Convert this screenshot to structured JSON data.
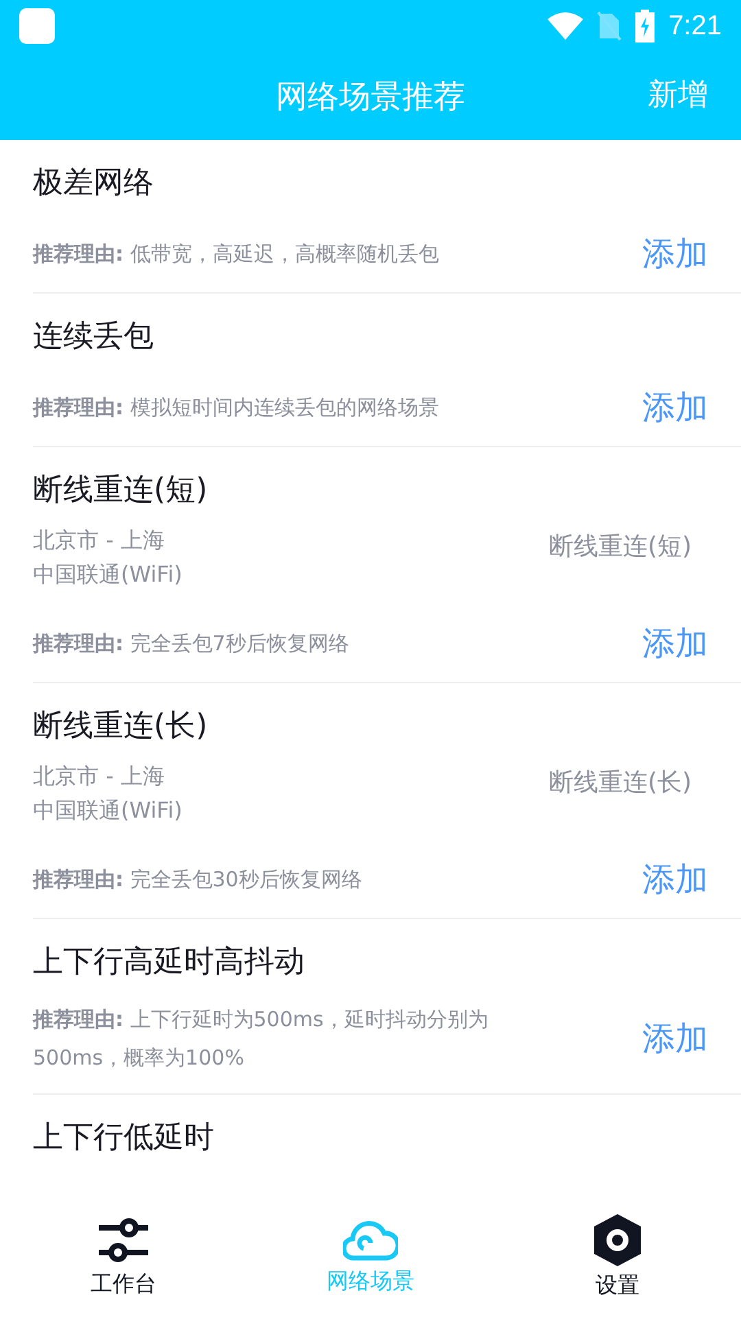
{
  "status_bar": {
    "time": "7:21"
  },
  "app_bar": {
    "title": "网络场景推荐",
    "action": "新增"
  },
  "scenarios": [
    {
      "kind": "simple",
      "title": "极差网络",
      "reason": "**推荐理由:** 低带宽，高延迟，高概率随机丢包",
      "add": "添加"
    },
    {
      "kind": "simple",
      "title": "连续丢包",
      "reason": "**推荐理由:** 模拟短时间内连续丢包的网络场景",
      "add": "添加"
    },
    {
      "kind": "route",
      "title": "断线重连(短)",
      "route": "北京市 - 上海",
      "carrier": "中国联通(WiFi)",
      "tag": "断线重连(短)",
      "reason": "**推荐理由:** 完全丢包7秒后恢复网络",
      "add": "添加"
    },
    {
      "kind": "route",
      "title": "断线重连(长)",
      "route": "北京市 - 上海",
      "carrier": "中国联通(WiFi)",
      "tag": "断线重连(长)",
      "reason": "**推荐理由:** 完全丢包30秒后恢复网络",
      "add": "添加"
    },
    {
      "kind": "simple",
      "title": "上下行高延时高抖动",
      "reason": "**推荐理由:** 上下行延时为500ms，延时抖动分别为500ms，概率为100%",
      "add": "添加"
    },
    {
      "kind": "title",
      "title": "上下行低延时"
    }
  ],
  "bottom_nav": [
    {
      "kind": "sliders",
      "label": "工作台",
      "selected": false
    },
    {
      "kind": "cloud",
      "label": "网络场景",
      "selected": true
    },
    {
      "kind": "settings",
      "label": "设置",
      "selected": false
    }
  ]
}
